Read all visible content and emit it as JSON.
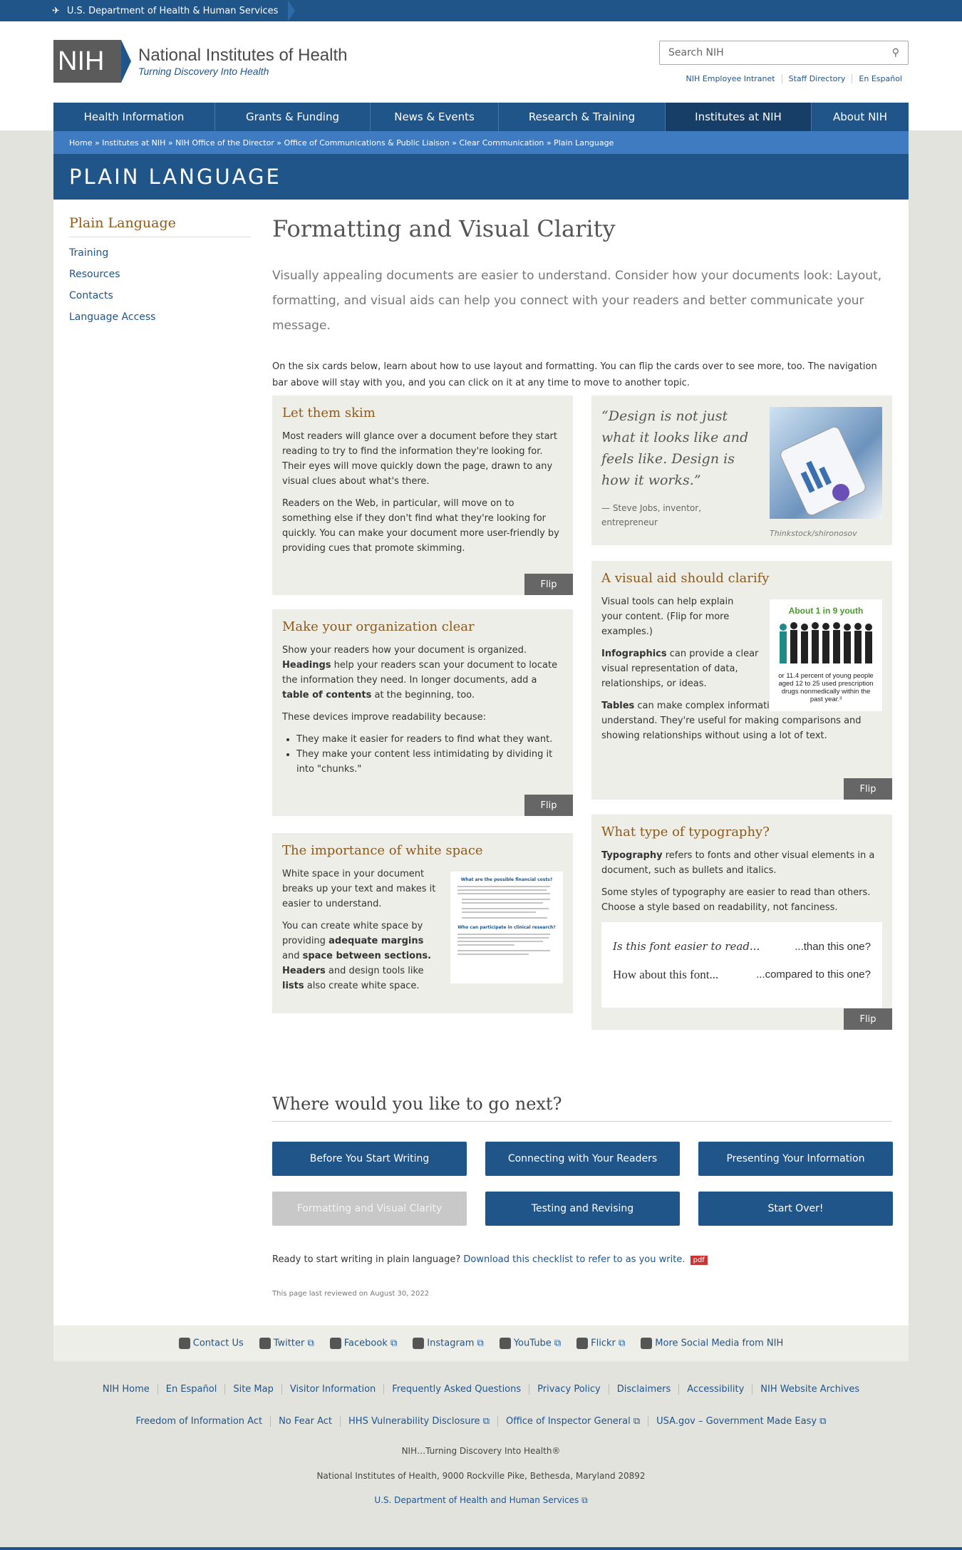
{
  "hhs": {
    "label": "U.S. Department of Health & Human Services"
  },
  "logo": {
    "abbr": "NIH",
    "name": "National Institutes of Health",
    "tagline": "Turning Discovery Into Health"
  },
  "search": {
    "placeholder": "Search NIH"
  },
  "utility": [
    "NIH Employee Intranet",
    "Staff Directory",
    "En Español"
  ],
  "nav": [
    "Health Information",
    "Grants & Funding",
    "News & Events",
    "Research & Training",
    "Institutes at NIH",
    "About NIH"
  ],
  "breadcrumb": "Home » Institutes at NIH » NIH Office of the Director » Office of Communications & Public Liaison » Clear Communication » Plain Language",
  "banner": "PLAIN LANGUAGE",
  "sidebar": {
    "title": "Plain Language",
    "items": [
      "Training",
      "Resources",
      "Contacts",
      "Language Access"
    ]
  },
  "page": {
    "title": "Formatting and Visual Clarity",
    "intro": "Visually appealing documents are easier to understand. Consider how your documents look: Layout, formatting, and visual aids can help you connect with your readers and better communicate your message.",
    "body": "On the six cards below, learn about how to use layout and formatting. You can flip the cards over to see more, too. The navigation bar above will stay with you, and you can click on it at any time to move to another topic."
  },
  "cards": {
    "skim": {
      "title": "Let them skim",
      "p1": "Most readers will glance over a document before they start reading to try to find the information they're looking for. Their eyes will move quickly down the page, drawn to any visual clues about what's there.",
      "p2": "Readers on the Web, in particular, will move on to something else if they don't find what they're looking for quickly. You can make your document more user-friendly by providing cues that promote skimming."
    },
    "quote": {
      "text": "“Design is not just what it looks like and feels like. Design is how it works.”",
      "author": "— Steve Jobs, inventor, entrepreneur",
      "credit": "Thinkstock/shironosov"
    },
    "org": {
      "title": "Make your organization clear",
      "p1a": "Show your readers how your document is organized. ",
      "p1b": "Headings",
      "p1c": " help your readers scan your document to locate the information they need. In longer documents, add a ",
      "p1d": "table of contents",
      "p1e": " at the beginning, too.",
      "p2": "These devices improve readability because:",
      "li1": "They make it easier for readers to find what they want.",
      "li2": "They make your content less intimidating by dividing it into \"chunks.\""
    },
    "visual": {
      "title": "A visual aid should clarify",
      "p1": "Visual tools can help explain your content. (Flip for more examples.)",
      "p2a": "Infographics",
      "p2b": " can provide a clear visual representation of data, relationships, or ideas.",
      "p3a": "Tables",
      "p3b": " can make complex information easier to understand. They're useful for making comparisons and showing relationships without using a lot of text.",
      "info_head": "About 1 in 9 youth",
      "info_foot": "or 11.4 percent of young people aged 12 to 25 used prescription drugs nonmedically within the past year.³"
    },
    "white": {
      "title": "The importance of white space",
      "p1": "White space in your document breaks up your text and makes it easier to understand.",
      "p2a": "You can create white space by providing ",
      "p2b": "adequate margins",
      "p2c": " and ",
      "p2d": "space between sections.",
      "p2e": " ",
      "p2f": "Headers",
      "p2g": " and design tools like ",
      "p2h": "lists",
      "p2i": " also create white space.",
      "doc_h1": "What are the possible financial costs?",
      "doc_h2": "Who can participate in clinical research?"
    },
    "typo": {
      "title": "What type of typography?",
      "p1a": "Typography",
      "p1b": " refers to fonts and other visual elements in a document, such as bullets and italics.",
      "p2": "Some styles of typography are easier to read than others. Choose a style based on readability, not fanciness.",
      "s1": "Is this font easier to read...",
      "s2": "...than this one?",
      "s3": "How about this font...",
      "s4": "...compared to this one?"
    },
    "flip": "Flip"
  },
  "next": {
    "title": "Where would you like to go next?",
    "buttons": [
      "Before You Start Writing",
      "Connecting with Your Readers",
      "Presenting Your Information",
      "Formatting and Visual Clarity",
      "Testing and Revising",
      "Start Over!"
    ]
  },
  "checklist": {
    "lead": "Ready to start writing in plain language? ",
    "link": "Download this checklist to refer to as you write.",
    "badge": "pdf"
  },
  "reviewed": "This page last reviewed on August 30, 2022",
  "social": [
    "Contact Us",
    "Twitter",
    "Facebook",
    "Instagram",
    "YouTube",
    "Flickr",
    "More Social Media from NIH"
  ],
  "footer1": [
    "NIH Home",
    "En Español",
    "Site Map",
    "Visitor Information",
    "Frequently Asked Questions",
    "Privacy Policy",
    "Disclaimers",
    "Accessibility",
    "NIH Website Archives"
  ],
  "footer2": [
    "Freedom of Information Act",
    "No Fear Act",
    "HHS Vulnerability Disclosure",
    "Office of Inspector General",
    "USA.gov – Government Made Easy"
  ],
  "footer3": "NIH…Turning Discovery Into Health®",
  "footer4": "National Institutes of Health, 9000 Rockville Pike, Bethesda, Maryland 20892",
  "footer5": "U.S. Department of Health and Human Services"
}
